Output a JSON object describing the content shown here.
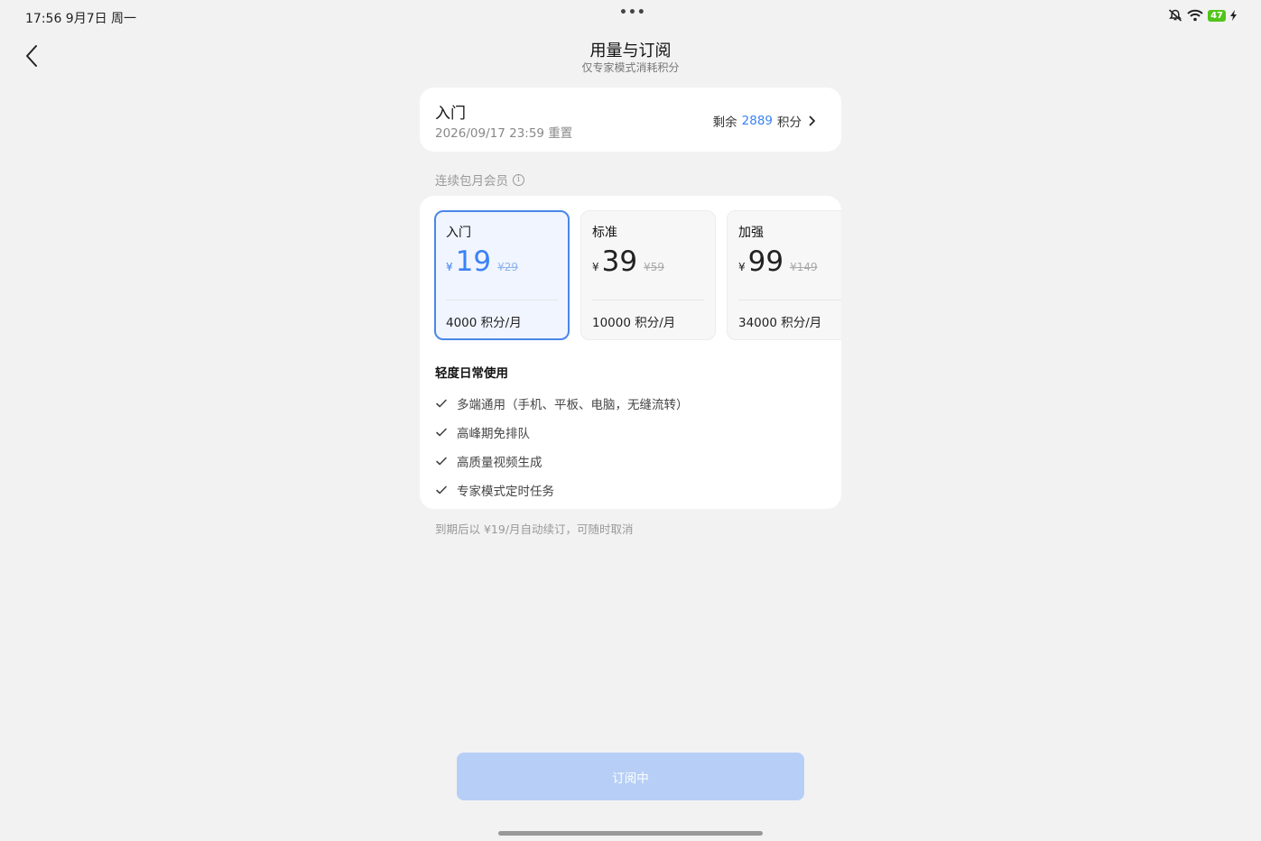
{
  "status_bar": {
    "time": "17:56  9月7日 周一",
    "dots": "•••",
    "battery": "47",
    "icons": [
      "mute-icon",
      "wifi-icon",
      "battery-icon",
      "charging-icon"
    ]
  },
  "header": {
    "title": "用量与订阅",
    "subtitle": "仅专家模式消耗积分"
  },
  "summary": {
    "plan": "入门",
    "reset": "2026/09/17 23:59 重置",
    "remaining_prefix": "剩余",
    "remaining_value": "2889",
    "remaining_suffix": "积分"
  },
  "section_label": "连续包月会员",
  "plans": [
    {
      "name": "入门",
      "currency": "¥",
      "price": "19",
      "original": "¥29",
      "credits": "4000 积分/月",
      "selected": true
    },
    {
      "name": "标准",
      "currency": "¥",
      "price": "39",
      "original": "¥59",
      "credits": "10000 积分/月",
      "selected": false
    },
    {
      "name": "加强",
      "currency": "¥",
      "price": "99",
      "original": "¥149",
      "credits": "34000 积分/月",
      "selected": false
    }
  ],
  "features": {
    "title": "轻度日常使用",
    "items": [
      "多端通用（手机、平板、电脑，无缝流转）",
      "高峰期免排队",
      "高质量视频生成",
      "专家模式定时任务"
    ]
  },
  "renew_note": "到期后以 ¥19/月自动续订，可随时取消",
  "subscribe_button": "订阅中",
  "colors": {
    "accent": "#3b82f6",
    "selected_border": "#4a87e8",
    "button_disabled": "#b7cff6",
    "background": "#f2f2f2"
  }
}
